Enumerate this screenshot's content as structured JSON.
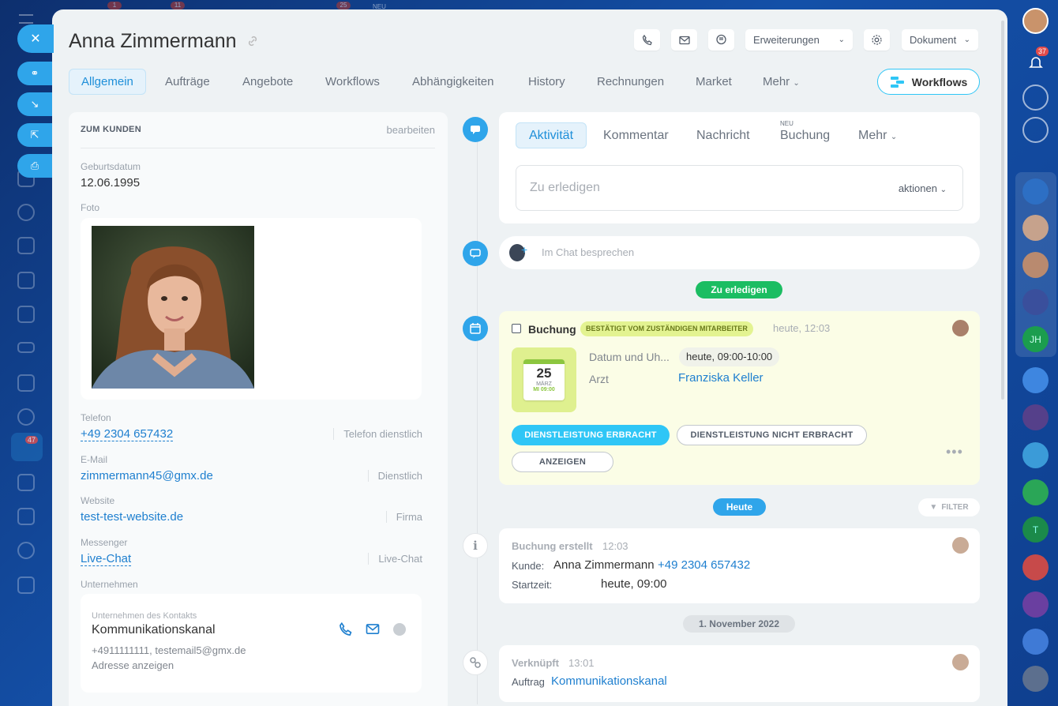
{
  "top_strip": {
    "badges": [
      "1",
      "11",
      "25"
    ],
    "new_label": "NEU"
  },
  "header": {
    "title": "Anna Zimmermann",
    "extensions_label": "Erweiterungen",
    "document_label": "Dokument"
  },
  "tabs": [
    "Allgemein",
    "Aufträge",
    "Angebote",
    "Workflows",
    "Abhängigkeiten",
    "History",
    "Rechnungen",
    "Market",
    "Mehr"
  ],
  "workflows_button": "Workflows",
  "customer": {
    "section_title": "ZUM KUNDEN",
    "edit_label": "bearbeiten",
    "birthday_label": "Geburtsdatum",
    "birthday": "12.06.1995",
    "photo_label": "Foto",
    "phone_label": "Telefon",
    "phone": "+49 2304 657432",
    "phone_type": "Telefon dienstlich",
    "email_label": "E-Mail",
    "email": "zimmermann45@gmx.de",
    "email_type": "Dienstlich",
    "website_label": "Website",
    "website": "test-test-website.de",
    "website_type": "Firma",
    "messenger_label": "Messenger",
    "messenger": "Live-Chat",
    "messenger_type": "Live-Chat",
    "company_section_label": "Unternehmen",
    "company": {
      "caption": "Unternehmen des Kontakts",
      "name": "Kommunikationskanal",
      "contacts": "+4911111111, testemail5@gmx.de",
      "address_link": "Adresse anzeigen"
    }
  },
  "activity": {
    "tabs": [
      "Aktivität",
      "Kommentar",
      "Nachricht",
      "Buchung",
      "Mehr"
    ],
    "new_badge": "NEU",
    "todo_placeholder": "Zu erledigen",
    "actions_label": "aktionen",
    "chat_placeholder": "Im Chat besprechen"
  },
  "timeline": {
    "todo_pill": "Zu erledigen",
    "booking": {
      "title": "Buchung",
      "status_badge": "BESTÄTIGT VOM ZUSTÄNDIGEN MITARBEITER",
      "time": "heute, 12:03",
      "calendar_day": "25",
      "calendar_month": "MÄRZ",
      "calendar_time": "MI 09:00",
      "datetime_label": "Datum und Uh...",
      "datetime_value": "heute, 09:00-10:00",
      "doctor_label": "Arzt",
      "doctor": "Franziska Keller",
      "btn_done": "DIENSTLEISTUNG ERBRACHT",
      "btn_not_done": "DIENSTLEISTUNG NICHT ERBRACHT",
      "btn_show": "ANZEIGEN"
    },
    "today_pill": "Heute",
    "filter_label": "FILTER",
    "created": {
      "title": "Buchung erstellt",
      "time": "12:03",
      "customer_label": "Kunde:",
      "customer_name": "Anna Zimmermann",
      "customer_phone": "+49 2304 657432",
      "start_label": "Startzeit:",
      "start_value": "heute, 09:00"
    },
    "date_pill": "1. November 2022",
    "linked": {
      "title": "Verknüpft",
      "time": "13:01",
      "type": "Auftrag",
      "link": "Kommunikationskanal"
    }
  },
  "right_strip": {
    "notification_count": "37",
    "avatar_initials": "JH",
    "green_initial": "T"
  },
  "left_strip": {
    "badge": "47"
  },
  "colors": {
    "accent": "#2fa5ea",
    "link": "#1e7fcf",
    "green": "#1bbd62",
    "booking_bg": "#fbfde6",
    "badge_lime": "#e3f391"
  }
}
